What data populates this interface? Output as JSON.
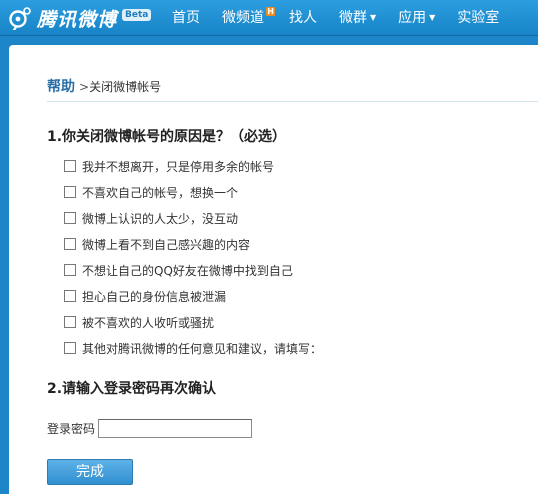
{
  "header": {
    "logo_text": "腾讯微博",
    "beta_badge": "Beta",
    "nav": [
      {
        "label": "首页"
      },
      {
        "label": "微频道",
        "badge": "H"
      },
      {
        "label": "找人"
      },
      {
        "label": "微群"
      },
      {
        "label": "应用"
      },
      {
        "label": "实验室"
      }
    ]
  },
  "breadcrumb": {
    "root": "帮助",
    "separator": ">",
    "current": "关闭微博帐号"
  },
  "question1": {
    "title": "1.你关闭微博帐号的原因是？（必选）",
    "options": [
      {
        "label": "我并不想离开，只是停用多余的帐号",
        "checked": false
      },
      {
        "label": "不喜欢自己的帐号，想换一个",
        "checked": false
      },
      {
        "label": "微博上认识的人太少，没互动",
        "checked": false
      },
      {
        "label": "微博上看不到自己感兴趣的内容",
        "checked": false
      },
      {
        "label": "不想让自己的QQ好友在微博中找到自己",
        "checked": false
      },
      {
        "label": "担心自己的身份信息被泄漏",
        "checked": false
      },
      {
        "label": "被不喜欢的人收听或骚扰",
        "checked": false
      },
      {
        "label": "其他对腾讯微博的任何意见和建议，请填写：",
        "checked": false
      }
    ]
  },
  "question2": {
    "title": "2.请输入登录密码再次确认",
    "password_label": "登录密码",
    "password_value": ""
  },
  "submit_label": "完成",
  "colors": {
    "brand_blue": "#1c86c8",
    "breadcrumb_blue": "#2a6fa8",
    "hot_badge": "#f08c1e"
  }
}
